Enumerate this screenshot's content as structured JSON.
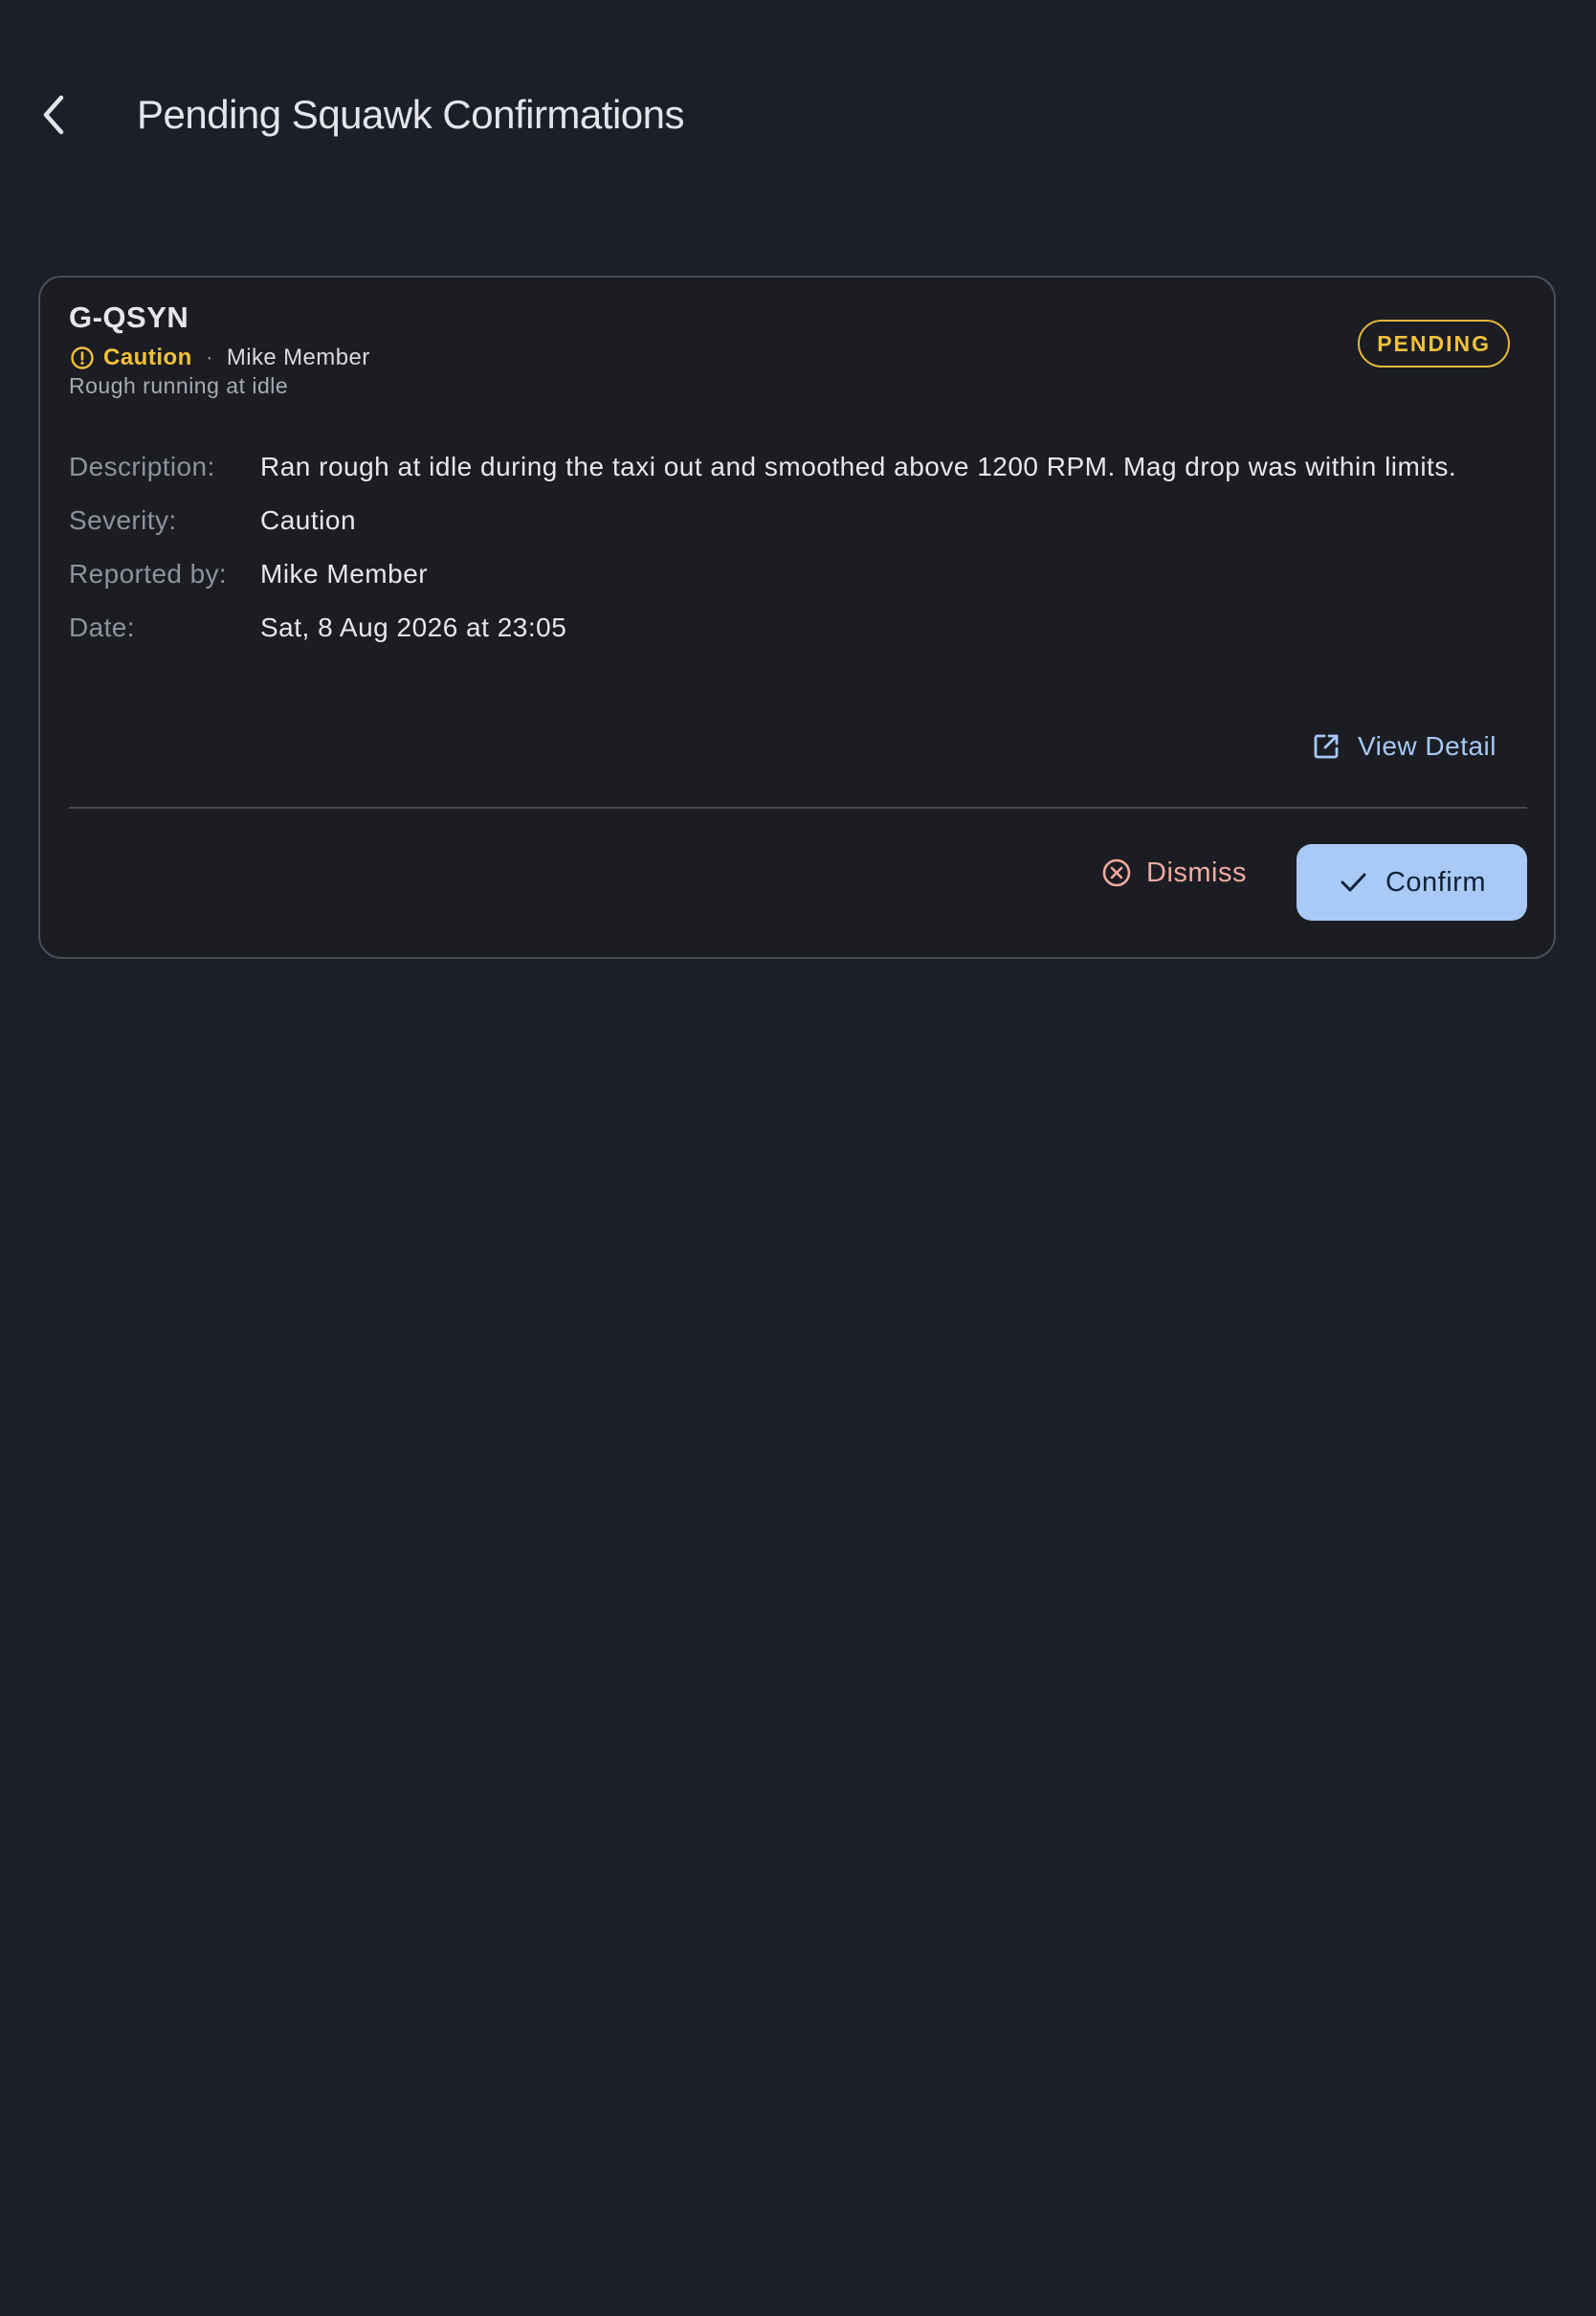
{
  "header": {
    "title": "Pending Squawk Confirmations",
    "back_icon": "chevron-left-icon"
  },
  "squawk": {
    "tail": "G-QSYN",
    "severity": "Caution",
    "severity_icon": "alert-circle-icon",
    "severity_color": "#f2c13c",
    "separator": "·",
    "reporter": "Mike Member",
    "summary": "Rough running at idle",
    "status": "PENDING",
    "details": {
      "description_label": "Description:",
      "description": "Ran rough at idle during the taxi out and smoothed above 1200 RPM. Mag drop was within limits.",
      "severity_label": "Severity:",
      "severity": "Caution",
      "reporter_label": "Reported by:",
      "reporter": "Mike Member",
      "date_label": "Date:",
      "date": "Sat, 8 Aug 2026 at 23:05"
    },
    "view_detail_label": "View Detail",
    "view_detail_icon": "open-in-new-icon"
  },
  "actions": {
    "dismiss_label": "Dismiss",
    "dismiss_icon": "cancel-circle-icon",
    "dismiss_color": "#f0aba0",
    "confirm_label": "Confirm",
    "confirm_icon": "check-icon",
    "confirm_color": "#a9c9f6"
  }
}
